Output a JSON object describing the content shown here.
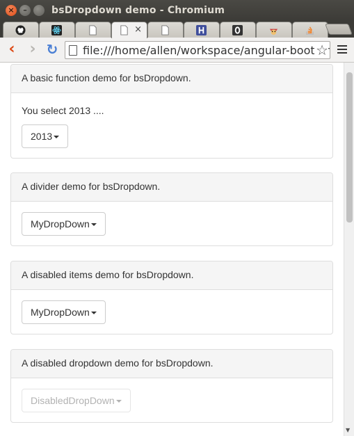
{
  "window": {
    "title": "bsDropdown demo - Chromium"
  },
  "tabs": [
    {
      "icon": "github-icon",
      "color": "#222222"
    },
    {
      "icon": "react-icon",
      "color": "#61dafb"
    },
    {
      "icon": "page-icon",
      "color": "#ffffff"
    },
    {
      "icon": "page-icon",
      "color": "#ffffff",
      "active": true,
      "close": "×"
    },
    {
      "icon": "page-icon",
      "color": "#ffffff"
    },
    {
      "icon": "hyper-icon",
      "color": "#3f4e9b"
    },
    {
      "icon": "o-icon",
      "color": "#333333"
    },
    {
      "icon": "mascot-icon",
      "color": "#cc4444"
    },
    {
      "icon": "stack-icon",
      "color": "#f48024"
    }
  ],
  "toolbar": {
    "back": "‹",
    "forward": "›",
    "reload": "↻",
    "url": "file:///home/allen/workspace/angular-bootstra",
    "star": "☆"
  },
  "panels": [
    {
      "heading": "A basic function demo for bsDropdown.",
      "text": "You select 2013 ....",
      "button": "2013",
      "disabled": false
    },
    {
      "heading": "A divider demo for bsDropdown.",
      "button": "MyDropDown",
      "disabled": false
    },
    {
      "heading": "A disabled items demo for bsDropdown.",
      "button": "MyDropDown",
      "disabled": false
    },
    {
      "heading": "A disabled dropdown demo for bsDropdown.",
      "button": "DisabledDropDown",
      "disabled": true
    }
  ],
  "colors": {
    "close_button": "#df4a16",
    "panel_heading_bg": "#f5f5f5",
    "panel_border": "#dddddd"
  }
}
